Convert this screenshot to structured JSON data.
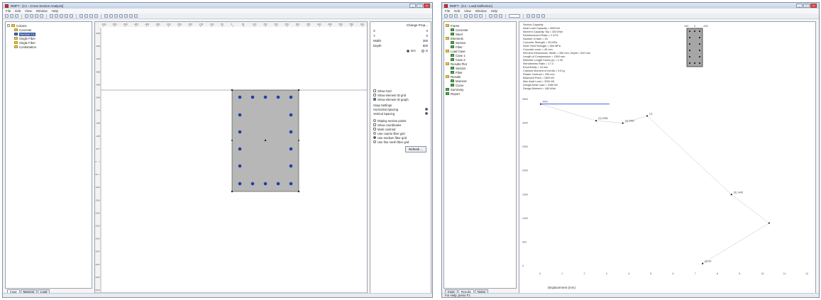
{
  "left_window": {
    "title": "RMFT - [C1 : Cross Section Analysis]",
    "menu": [
      "File",
      "Edit",
      "View",
      "Window",
      "Help"
    ],
    "tree": [
      {
        "label": "Column",
        "level": 0,
        "expander": "−"
      },
      {
        "label": "Concrete",
        "level": 1
      },
      {
        "label": "Section C1",
        "level": 1,
        "selected": true
      },
      {
        "label": "Single Fiber",
        "level": 1
      },
      {
        "label": "Single Fiber",
        "level": 1
      },
      {
        "label": "Combination",
        "level": 1
      }
    ],
    "tabs": [
      "Input",
      "Material",
      "Load"
    ],
    "ruler_top": [
      "-600",
      "-550",
      "-500",
      "-450",
      "-400",
      "-350",
      "-300",
      "-250",
      "-200",
      "-150",
      "-100",
      "-50",
      "0",
      "50",
      "100",
      "150",
      "200",
      "250",
      "300",
      "350",
      "400",
      "450",
      "500",
      "550",
      "600"
    ],
    "ruler_left": [
      "-500",
      "-450",
      "-400",
      "-350",
      "-300",
      "-250",
      "-200",
      "-150",
      "-100",
      "-50",
      "0",
      "50",
      "100",
      "150",
      "200",
      "250",
      "300",
      "350",
      "400",
      "450",
      "500"
    ],
    "properties": {
      "header": "Change Prop...",
      "rows": [
        {
          "label": "X",
          "value": "0"
        },
        {
          "label": "Y",
          "value": "0"
        },
        {
          "label": "Width",
          "value": "300"
        },
        {
          "label": "Depth",
          "value": "500"
        }
      ],
      "units_radio": [
        "mm",
        "in"
      ],
      "grid_checks": [
        {
          "label": "Show Grid",
          "on": false
        },
        {
          "label": "Show element ID grid",
          "on": false
        },
        {
          "label": "Show element ID graph",
          "on": true
        }
      ],
      "snap_header": "Snap Settings",
      "snap_rows": [
        "Horizontal Spacing",
        "Vertical Spacing"
      ],
      "options": [
        {
          "label": "Display section points",
          "type": "radio",
          "on": false
        },
        {
          "label": "Show coordinates",
          "type": "check",
          "on": false
        },
        {
          "label": "Mark centroid",
          "type": "check",
          "on": false
        },
        {
          "label": "Use coarse fiber grid",
          "type": "radio",
          "on": false
        },
        {
          "label": "Use medium fiber grid",
          "type": "radio",
          "on": true
        },
        {
          "label": "Use fine mesh fiber grid",
          "type": "radio",
          "on": false
        }
      ],
      "button": "Refresh ..."
    },
    "status": ""
  },
  "right_window": {
    "title": "RMFT - [C1 : Load Deflection]",
    "menu": [
      "File",
      "Edit",
      "View",
      "Window",
      "Help"
    ],
    "tree": [
      {
        "label": "Frame",
        "level": 0,
        "icon": "folder"
      },
      {
        "label": "Concrete",
        "level": 1
      },
      {
        "label": "Steel",
        "level": 1
      },
      {
        "label": "Elements",
        "level": 0,
        "icon": "folder"
      },
      {
        "label": "Section",
        "level": 1
      },
      {
        "label": "Fiber",
        "level": 1
      },
      {
        "label": "Load Case",
        "level": 0,
        "icon": "folder"
      },
      {
        "label": "Case 1",
        "level": 1
      },
      {
        "label": "Case 2",
        "level": 1
      },
      {
        "label": "Results Plot",
        "level": 0,
        "icon": "folder"
      },
      {
        "label": "Section",
        "level": 1
      },
      {
        "label": "Fiber",
        "level": 1
      },
      {
        "label": "Results",
        "level": 0,
        "icon": "folder"
      },
      {
        "label": "Moment",
        "level": 1
      },
      {
        "label": "Curve",
        "level": 1
      },
      {
        "label": "Summary",
        "level": 0
      },
      {
        "label": "Report",
        "level": 0
      }
    ],
    "tabs": [
      "Input",
      "Results",
      "Notes"
    ],
    "info_lines": [
      "Section Capacity",
      "Axial Load Capacity = 3000 kN",
      "Moment Capacity: My = 420 kNm",
      "Reinforcement Ratio = 2.47%",
      "Number of bars = 16",
      "Concrete Strength = 30 MPa",
      "Steel Yield Strength = 460 MPa",
      "Concrete cover = 40 mm",
      "Element Dimensions: Width = 300 mm, Depth = 500 mm",
      "Length of Compression = 1500 mm",
      "Effective Length Factor (k) = 1.00",
      "Slenderness Ratio = 17.3",
      "Eccentricity = 15 mm",
      "Cracked Moment of Inertia = 0.6 Ig",
      "Plastic Centroid = 250 mm",
      "Balanced Point = 1500 kN",
      "Max Axial Load = 3200 kN",
      "Design Axial Load = 2450 kN",
      "Design Moment = 180 kNm"
    ],
    "thumb_ticks": [
      "100",
      "0",
      "-100"
    ],
    "status": "For Help, press F1"
  },
  "chart_data": {
    "type": "line",
    "title": "",
    "xlabel": "Displacement (mm)",
    "ylabel": "",
    "xlim": [
      0,
      12
    ],
    "ylim": [
      0,
      3500
    ],
    "x_ticks": [
      "0",
      "1",
      "2",
      "3",
      "4",
      "5",
      "6",
      "7",
      "8",
      "9",
      "10",
      "11",
      "12"
    ],
    "y_ticks": [
      "0",
      "500",
      "1000",
      "1500",
      "2000",
      "2500",
      "3000",
      "3500"
    ],
    "grid": false,
    "series": [
      {
        "name": "",
        "x": [
          0,
          2.5,
          3.7,
          4.8,
          8.6,
          10.3,
          7.3
        ],
        "y": [
          3400,
          3050,
          3000,
          3150,
          1500,
          900,
          50
        ],
        "color": "#888888"
      },
      {
        "name": "",
        "x": [
          0,
          3.1
        ],
        "y": [
          3400,
          3400
        ],
        "color": "#3a4ccc"
      }
    ],
    "point_labels": [
      {
        "x": 2.5,
        "y": 3050,
        "text": "(3) 2956"
      },
      {
        "x": 3.7,
        "y": 3000,
        "text": "(4) 2983"
      },
      {
        "x": 4.8,
        "y": 3150,
        "text": "(1)"
      },
      {
        "x": 8.6,
        "y": 1500,
        "text": "(5) 1445"
      },
      {
        "x": 7.3,
        "y": 50,
        "text": "(6) 50"
      }
    ],
    "top_label": "3400"
  }
}
